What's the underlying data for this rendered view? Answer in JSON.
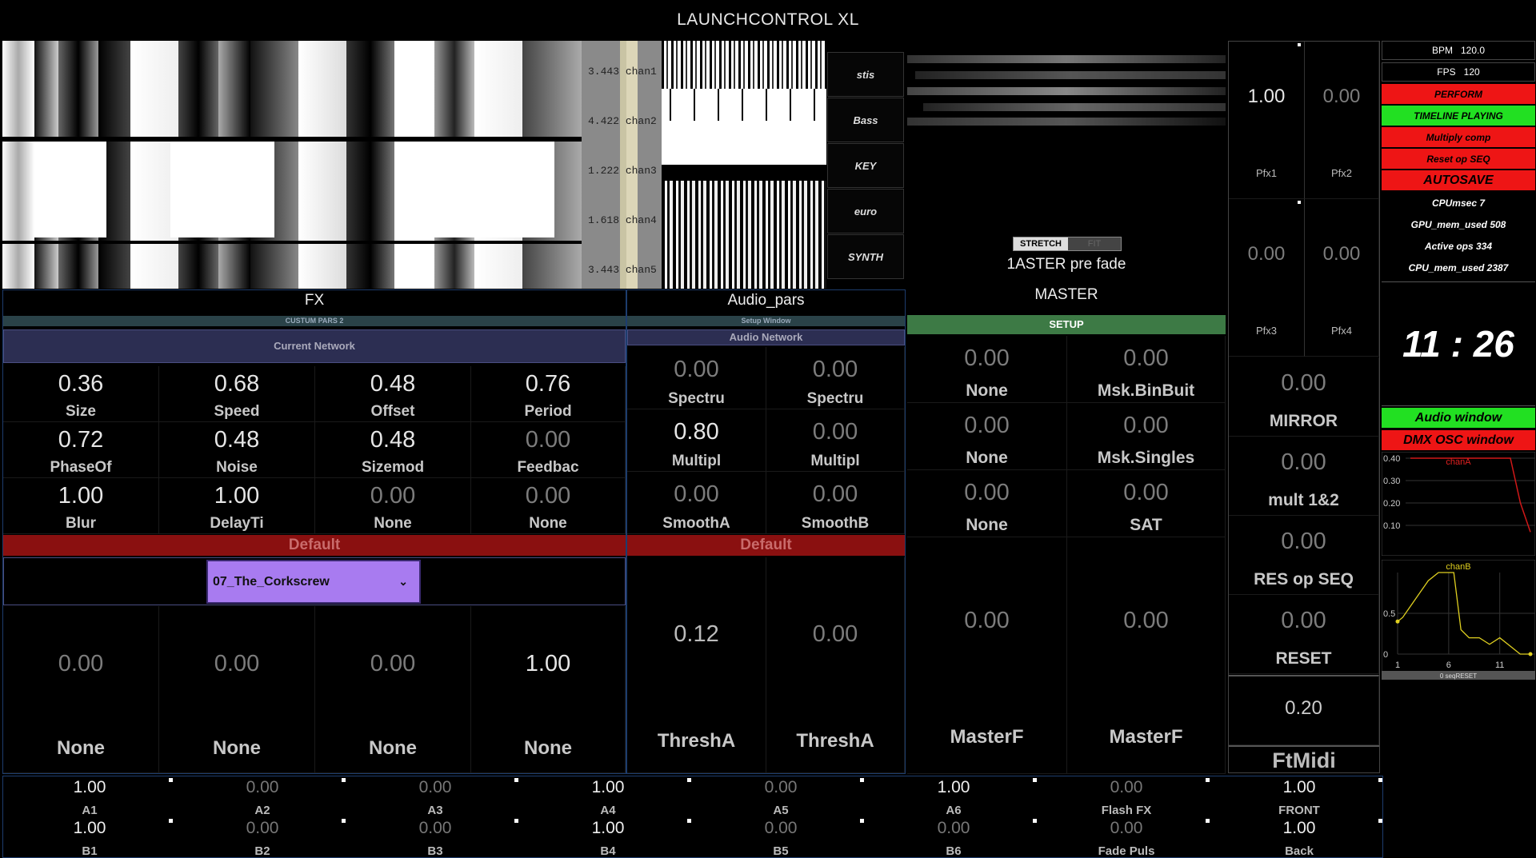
{
  "window": {
    "title": "LAUNCHCONTROL XL"
  },
  "channels": [
    {
      "value": "3.443",
      "name": "chan1"
    },
    {
      "value": "4.422",
      "name": "chan2"
    },
    {
      "value": "1.222",
      "name": "chan3"
    },
    {
      "value": "1.618",
      "name": "chan4"
    },
    {
      "value": "3.443",
      "name": "chan5"
    }
  ],
  "selector_buttons": [
    "stis",
    "Bass",
    "KEY",
    "euro",
    "SYNTH"
  ],
  "fx": {
    "title": "FX",
    "subtitle": "CUSTUM PARS 2",
    "network": "Current Network",
    "params": [
      {
        "value": "0.36",
        "label": "Size"
      },
      {
        "value": "0.68",
        "label": "Speed"
      },
      {
        "value": "0.48",
        "label": "Offset"
      },
      {
        "value": "0.76",
        "label": "Period"
      },
      {
        "value": "0.72",
        "label": "PhaseOf"
      },
      {
        "value": "0.48",
        "label": "Noise"
      },
      {
        "value": "0.48",
        "label": "Sizemod"
      },
      {
        "value": "0.00",
        "label": "Feedbac"
      },
      {
        "value": "1.00",
        "label": "Blur"
      },
      {
        "value": "1.00",
        "label": "DelayTi"
      },
      {
        "value": "0.00",
        "label": "None"
      },
      {
        "value": "0.00",
        "label": "None"
      }
    ],
    "preset_bar": "Default",
    "dropdown_value": "07_The_Corkscrew",
    "faders": [
      {
        "value": "0.00",
        "label": "None"
      },
      {
        "value": "0.00",
        "label": "None"
      },
      {
        "value": "0.00",
        "label": "None"
      },
      {
        "value": "1.00",
        "label": "None"
      }
    ]
  },
  "audio": {
    "title": "Audio_pars",
    "subtitle": "Setup Window",
    "network": "Audio Network",
    "params": [
      {
        "value": "0.00",
        "label": "Spectru"
      },
      {
        "value": "0.00",
        "label": "Spectru"
      },
      {
        "value": "0.80",
        "label": "Multipl"
      },
      {
        "value": "0.00",
        "label": "Multipl"
      },
      {
        "value": "0.00",
        "label": "SmoothA"
      },
      {
        "value": "0.00",
        "label": "SmoothB"
      }
    ],
    "preset_bar": "Default",
    "faders": [
      {
        "value": "0.12",
        "label": "ThreshA"
      },
      {
        "value": "0.00",
        "label": "ThreshA"
      }
    ]
  },
  "master": {
    "stretch_label": "STRETCH",
    "fit_label": "FIT",
    "prefade_label": "1ASTER pre fade",
    "title": "MASTER",
    "setup": "SETUP",
    "params": [
      {
        "value": "0.00",
        "label": "None"
      },
      {
        "value": "0.00",
        "label": "Msk.BinBuit"
      },
      {
        "value": "0.00",
        "label": "None"
      },
      {
        "value": "0.00",
        "label": "Msk.Singles"
      },
      {
        "value": "0.00",
        "label": "None"
      },
      {
        "value": "0.00",
        "label": "SAT"
      }
    ],
    "faders": [
      {
        "value": "0.00",
        "label": "MasterF"
      },
      {
        "value": "0.00",
        "label": "MasterF"
      }
    ]
  },
  "pfx": [
    {
      "value": "1.00",
      "label": "Pfx1"
    },
    {
      "value": "0.00",
      "label": "Pfx2"
    },
    {
      "value": "0.00",
      "label": "Pfx3"
    },
    {
      "value": "0.00",
      "label": "Pfx4"
    }
  ],
  "right_controls": [
    {
      "value": "0.00",
      "label": "MIRROR"
    },
    {
      "value": "0.00",
      "label": "mult 1&2"
    },
    {
      "value": "0.00",
      "label": "RES op SEQ"
    },
    {
      "value": "0.00",
      "label": "RESET"
    }
  ],
  "ftmidi": {
    "value": "0.20",
    "label": "FtMidi"
  },
  "status": {
    "bpm_label": "BPM",
    "bpm": "120.0",
    "fps_label": "FPS",
    "fps": "120",
    "perform": "PERFORM",
    "timeline": "TIMELINE PLAYING",
    "multiply": "Multiply comp",
    "reset_seq": "Reset op SEQ",
    "autosave": "AUTOSAVE",
    "cpu": "CPUmsec 7",
    "gpu_mem": "GPU_mem_used 508",
    "active_ops": "Active ops 334",
    "cpu_mem": "CPU_mem_used 2387",
    "clock": "11 : 26",
    "audio_window": "Audio window",
    "dmx_window": "DMX OSC window"
  },
  "colors": {
    "green": "#22e022",
    "red": "#ee1515",
    "default_bar": "#8a1010",
    "setup_bar": "#3d7a45",
    "dropdown": "#a87bf0"
  },
  "chart_data": [
    {
      "type": "line",
      "series": [
        {
          "name": "chanA",
          "values": [
            0.4,
            0.4,
            0.4,
            0.4,
            0.4,
            0.4,
            0.4,
            0.4,
            0.4,
            0.4,
            0.4,
            0.2,
            0.07
          ]
        }
      ],
      "y_ticks": [
        "0.40",
        "0.30",
        "0.20",
        "0.10"
      ],
      "ylim": [
        0,
        0.4
      ]
    },
    {
      "type": "line",
      "series": [
        {
          "name": "chanB",
          "x": [
            1,
            1.5,
            4,
            5,
            6.5,
            7.2,
            8,
            9,
            10,
            11,
            12,
            13,
            14
          ],
          "values": [
            0.4,
            0.45,
            0.9,
            1.0,
            1.0,
            0.3,
            0.2,
            0.2,
            0.12,
            0.2,
            0.1,
            0.0,
            0.0
          ]
        }
      ],
      "y_ticks": [
        "0.5",
        "0"
      ],
      "x_ticks": [
        "1",
        "6",
        "11"
      ],
      "xlabel": "0 seqRESET",
      "ylim": [
        0,
        1
      ]
    }
  ],
  "bottom_row_a": [
    {
      "value": "1.00",
      "label": "A1"
    },
    {
      "value": "0.00",
      "label": "A2"
    },
    {
      "value": "0.00",
      "label": "A3"
    },
    {
      "value": "1.00",
      "label": "A4"
    },
    {
      "value": "0.00",
      "label": "A5"
    },
    {
      "value": "1.00",
      "label": "A6"
    },
    {
      "value": "0.00",
      "label": "Flash FX"
    },
    {
      "value": "1.00",
      "label": "FRONT"
    }
  ],
  "bottom_row_b": [
    {
      "value": "1.00",
      "label": "B1"
    },
    {
      "value": "0.00",
      "label": "B2"
    },
    {
      "value": "0.00",
      "label": "B3"
    },
    {
      "value": "1.00",
      "label": "B4"
    },
    {
      "value": "0.00",
      "label": "B5"
    },
    {
      "value": "0.00",
      "label": "B6"
    },
    {
      "value": "0.00",
      "label": "Fade Puls"
    },
    {
      "value": "1.00",
      "label": "Back"
    }
  ]
}
